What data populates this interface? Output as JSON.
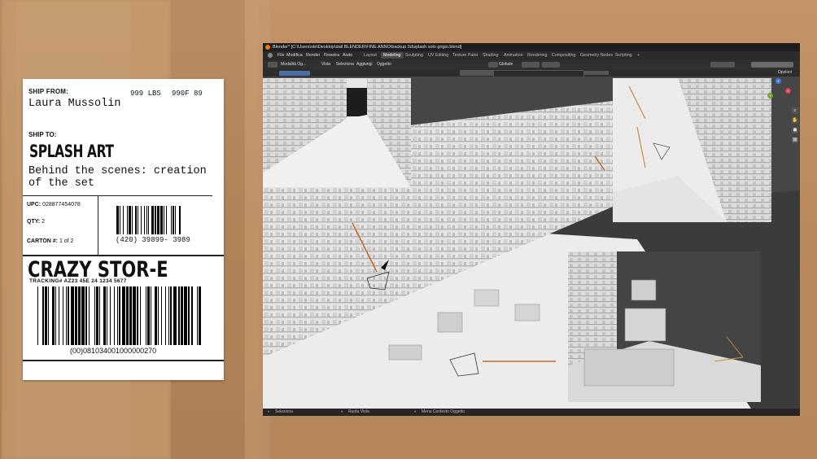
{
  "label": {
    "ship_from_title": "SHIP FROM:",
    "weight": "999 LBS",
    "weight_code": "990F 89",
    "from_name": "Laura Mussolin",
    "ship_to_title": "SHIP TO:",
    "to_name": "SPLASH ART",
    "to_description": "Behind the scenes: creation of the set",
    "upc_label": "UPC:",
    "upc_value": "028877454078",
    "qty_label": "QTY:",
    "qty_value": "2",
    "carton_label": "CARTON #:",
    "carton_value": "1 of 2",
    "barcode_small_number": "(420) 39899- 3989",
    "store_name": "CRAZY STOR-E",
    "tracking": "TRACKING# AZ23 45E 24 1234 5677",
    "barcode_big_number": "(00)081034001000000270"
  },
  "blender": {
    "title": "Blender* [C:\\Users\\ste\\Desktop\\dall BLENDER\\FINE ANNO\\backup 3d\\splash solo grigio.blend]",
    "menu": [
      "File",
      "Modifica",
      "Render",
      "Finestra",
      "Aiuto"
    ],
    "workspaces": [
      "Layout",
      "Modeling",
      "Sculpting",
      "UV Editing",
      "Texture Paint",
      "Shading",
      "Animation",
      "Rendering",
      "Compositing",
      "Geometry Nodes",
      "Scripting"
    ],
    "active_workspace": "Modeling",
    "add_tab": "+",
    "mode": "Modalità Og...",
    "toolbar_menus": [
      "Vista",
      "Seleziona",
      "Aggiungi",
      "Oggetto"
    ],
    "transform_orientation": "Globale",
    "options": "Opzioni",
    "status": {
      "select": "Seleziona",
      "rotate": "Ruota Vista",
      "context": "Menu Contesto Oggetto"
    },
    "gizmo": {
      "x": "X",
      "y": "Y",
      "z": "Z"
    }
  },
  "colors": {
    "cardboard": "#b7895c",
    "blender_bg": "#3d3d3d",
    "accent_orange": "#e87d0d",
    "axis_x": "#d6444d",
    "axis_y": "#6ea52b",
    "axis_z": "#3b7de0"
  }
}
